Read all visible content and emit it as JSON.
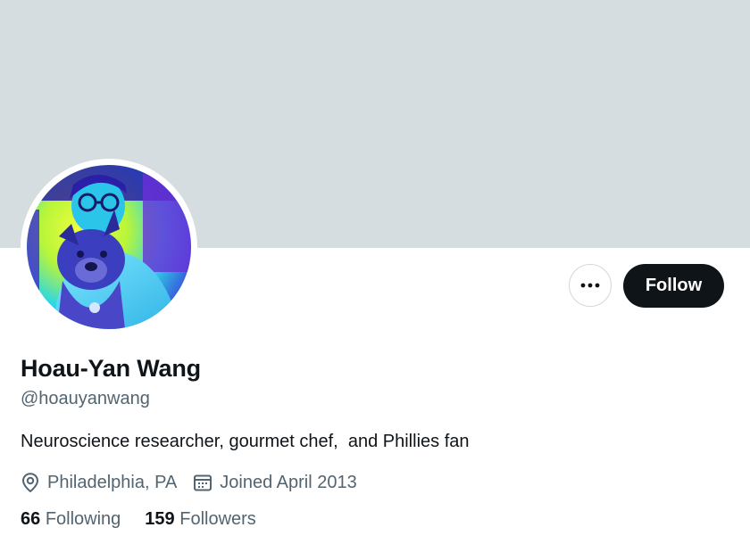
{
  "profile": {
    "name": "Hoau-Yan Wang",
    "handle": "@hoauyanwang",
    "bio": "Neuroscience researcher, gourmet chef,  and Phillies fan",
    "location": "Philadelphia, PA",
    "joined": "Joined April 2013",
    "following_count": "66",
    "following_label": "Following",
    "followers_count": "159",
    "followers_label": "Followers"
  },
  "actions": {
    "more_icon": "more-horizontal-icon",
    "follow_label": "Follow"
  },
  "icons": {
    "location": "location-pin-icon",
    "calendar": "calendar-icon"
  },
  "colors": {
    "banner": "#d6dde1",
    "primary_text": "#0f1419",
    "secondary_text": "#536471",
    "follow_button_bg": "#0f1419",
    "border": "#cfd9de"
  }
}
